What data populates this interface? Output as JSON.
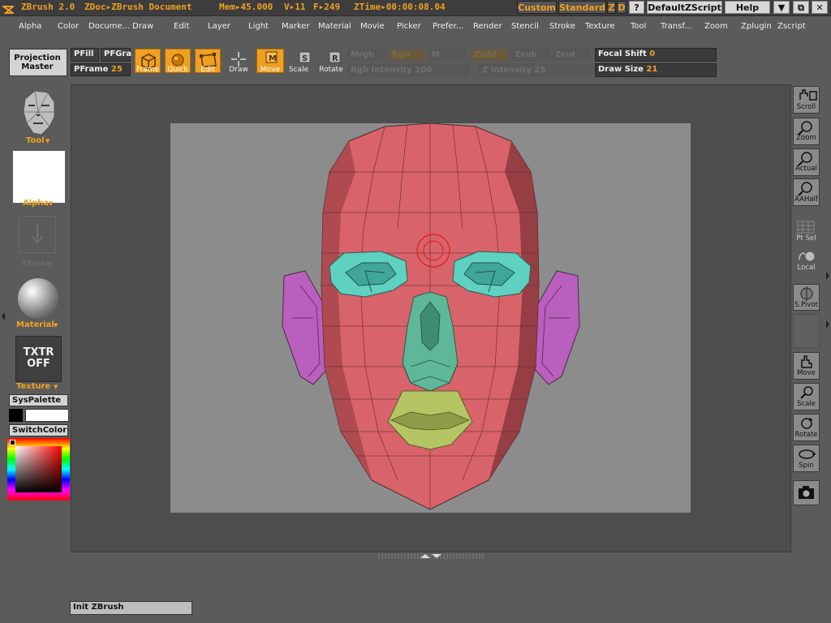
{
  "titlebar": {
    "app": "ZBrush 2.0",
    "doc": "ZDoc▸ZBrush Document",
    "mem": "Mem▸45.000",
    "verts": "V▸11",
    "faces": "F▸249",
    "ztime": "ZTime▸00:00:08.04",
    "btn_custom": "Custom",
    "btn_standard": "Standard",
    "btn_z": "Z",
    "btn_d": "D",
    "btn_q": "?",
    "btn_defaultzscript": "DefaultZScript",
    "btn_help": "Help"
  },
  "menus": [
    "Alpha",
    "Color",
    "Docume...",
    "Draw",
    "Edit",
    "Layer",
    "Light",
    "Marker",
    "Material",
    "Movie",
    "Picker",
    "Prefer...",
    "Render",
    "Stencil",
    "Stroke",
    "Texture",
    "Tool",
    "Transf...",
    "Zoom",
    "Zplugin",
    "Zscript"
  ],
  "toolbar": {
    "projection_master": "Projection Master",
    "pfill": "PFill",
    "pfgra": "PFGra",
    "pframe_label": "PFrame",
    "pframe_value": "25",
    "frame": "Frame",
    "quick": "Quick",
    "edit": "Edit",
    "draw": "Draw",
    "move": "Move",
    "scale": "Scale",
    "rotate": "Rotate",
    "mrgb": "Mrgb",
    "rgb": "Rgb",
    "m": "M",
    "zadd": "Zadd",
    "zsub": "Zsub",
    "zcut": "Zcut",
    "rgb_intensity": "Rgb Intensity 100",
    "z_intensity": "Z Intensity 25",
    "focal_shift_label": "Focal Shift",
    "focal_shift_value": "0",
    "draw_size_label": "Draw Size",
    "draw_size_value": "21"
  },
  "left": {
    "tool": "Tool",
    "alpha": "Alpha",
    "stroke": "Stroke",
    "material": "Material",
    "txtr_line1": "TXTR",
    "txtr_line2": "OFF",
    "texture": "Texture",
    "syspalette": "SysPalette",
    "switchcolor": "SwitchColor"
  },
  "right": [
    "Scroll",
    "Zoom",
    "Actual",
    "AAHalf",
    "Pt Sel",
    "Local",
    "S.Pivot",
    "Move",
    "Scale",
    "Rotate",
    "Spin"
  ],
  "status": "Init ZBrush",
  "colors": {
    "accent": "#f0a020",
    "face_red": "#d9636a",
    "eyes": "#5ed1c0",
    "nose": "#5fb79a",
    "mouth": "#b5c564",
    "ears": "#b95fbd",
    "canvas": "#8c8c8c"
  }
}
